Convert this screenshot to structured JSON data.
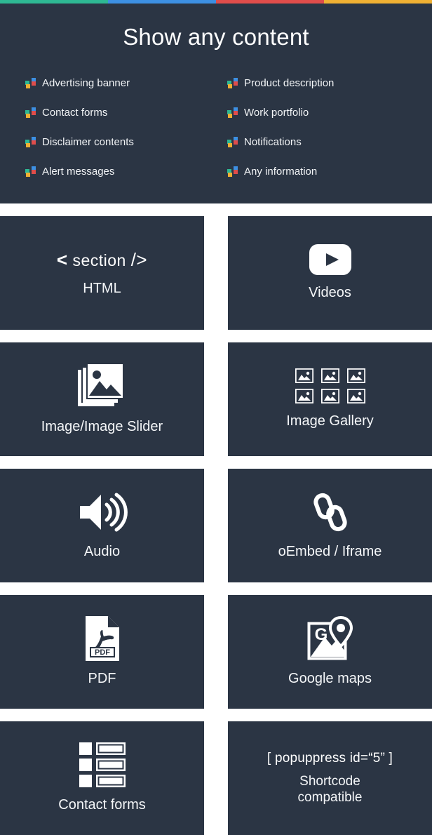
{
  "colors": {
    "dark": "#2b3544",
    "page_bg": "#ffffff",
    "text": "#ffffff",
    "strip_green": "#2eb893",
    "strip_blue": "#3d90e3",
    "strip_red": "#e04d4b",
    "strip_yellow": "#f0b133",
    "bullet_blue": "#3d90e3",
    "bullet_green": "#2eb893",
    "bullet_red": "#e04d4b",
    "bullet_orange": "#f0b133"
  },
  "top_strip": [
    {
      "name": "strip-segment-green",
      "color": "#2eb893"
    },
    {
      "name": "strip-segment-blue",
      "color": "#3d90e3"
    },
    {
      "name": "strip-segment-red",
      "color": "#e04d4b"
    },
    {
      "name": "strip-segment-yellow",
      "color": "#f0b133"
    }
  ],
  "hero": {
    "title": "Show any content",
    "features": [
      {
        "label": "Advertising banner",
        "icon": "pinwheel-bullet-icon"
      },
      {
        "label": "Product description",
        "icon": "pinwheel-bullet-icon"
      },
      {
        "label": "Contact forms",
        "icon": "pinwheel-bullet-icon"
      },
      {
        "label": "Work portfolio",
        "icon": "pinwheel-bullet-icon"
      },
      {
        "label": "Disclaimer contents",
        "icon": "pinwheel-bullet-icon"
      },
      {
        "label": "Notifications",
        "icon": "pinwheel-bullet-icon"
      },
      {
        "label": "Alert messages",
        "icon": "pinwheel-bullet-icon"
      },
      {
        "label": "Any information",
        "icon": "pinwheel-bullet-icon"
      }
    ]
  },
  "tiles": [
    {
      "label": "HTML",
      "icon": "code-section-icon",
      "code_open": "<",
      "code_word": "section",
      "code_close": "/>"
    },
    {
      "label": "Videos",
      "icon": "youtube-play-icon"
    },
    {
      "label": "Image/Image Slider",
      "icon": "image-stack-icon"
    },
    {
      "label": "Image Gallery",
      "icon": "image-gallery-icon"
    },
    {
      "label": "Audio",
      "icon": "speaker-volume-icon"
    },
    {
      "label": "oEmbed / Iframe",
      "icon": "chain-link-icon"
    },
    {
      "label": "PDF",
      "icon": "pdf-file-icon",
      "badge": "PDF"
    },
    {
      "label": "Google maps",
      "icon": "google-maps-pin-icon",
      "badge": "G"
    },
    {
      "label": "Contact forms",
      "icon": "form-list-icon"
    },
    {
      "label": "Shortcode compatible",
      "icon": "shortcode-text-icon",
      "code": "[ popuppress id=“5” ]",
      "caption_line1": "Shortcode",
      "caption_line2": "compatible"
    }
  ]
}
